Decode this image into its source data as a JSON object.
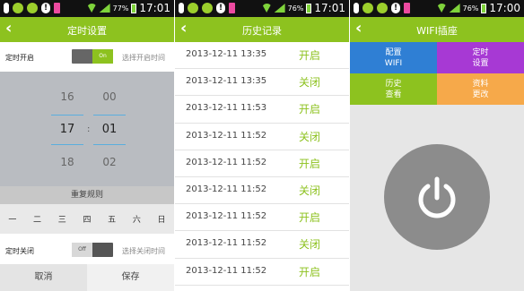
{
  "colors": {
    "accent": "#8dc21f",
    "status_bar": "#111111",
    "tile_blue": "#2f7fd4",
    "tile_purple": "#a739d4",
    "tile_green": "#8dc21f",
    "tile_orange": "#f6a94a"
  },
  "panel1": {
    "status": {
      "battery": "77%",
      "time": "17:01"
    },
    "title": "定时设置",
    "back_icon": "arrow-left-icon",
    "on_row": {
      "label": "定时开启",
      "toggle": "On",
      "hint": "选择开启时间"
    },
    "picker": {
      "hours": [
        "16",
        "17",
        "18"
      ],
      "minutes": [
        "00",
        "01",
        "02"
      ],
      "colon": ":"
    },
    "repeat_label": "重复规则",
    "days": [
      "一",
      "二",
      "三",
      "四",
      "五",
      "六",
      "日"
    ],
    "off_row": {
      "label": "定时关闭",
      "toggle": "Off",
      "hint": "选择关闭时间"
    },
    "cancel": "取消",
    "save": "保存"
  },
  "panel2": {
    "status": {
      "battery": "76%",
      "time": "17:01"
    },
    "title": "历史记录",
    "back_icon": "arrow-left-icon",
    "rows": [
      {
        "date": "2013-12-11 13:35",
        "state": "开启"
      },
      {
        "date": "2013-12-11 13:35",
        "state": "关闭"
      },
      {
        "date": "2013-12-11 11:53",
        "state": "开启"
      },
      {
        "date": "2013-12-11 11:52",
        "state": "关闭"
      },
      {
        "date": "2013-12-11 11:52",
        "state": "开启"
      },
      {
        "date": "2013-12-11 11:52",
        "state": "关闭"
      },
      {
        "date": "2013-12-11 11:52",
        "state": "开启"
      },
      {
        "date": "2013-12-11 11:52",
        "state": "关闭"
      },
      {
        "date": "2013-12-11 11:52",
        "state": "开启"
      }
    ]
  },
  "panel3": {
    "status": {
      "battery": "76%",
      "time": "17:00"
    },
    "title": "WIFI插座",
    "back_icon": "arrow-left-icon",
    "tiles": {
      "config_wifi": [
        "配置",
        "WIFI"
      ],
      "timer_settings": [
        "定时",
        "设置"
      ],
      "view_history": [
        "历史",
        "查看"
      ],
      "edit_profile": [
        "资料",
        "更改"
      ]
    },
    "power_icon": "power-icon"
  }
}
